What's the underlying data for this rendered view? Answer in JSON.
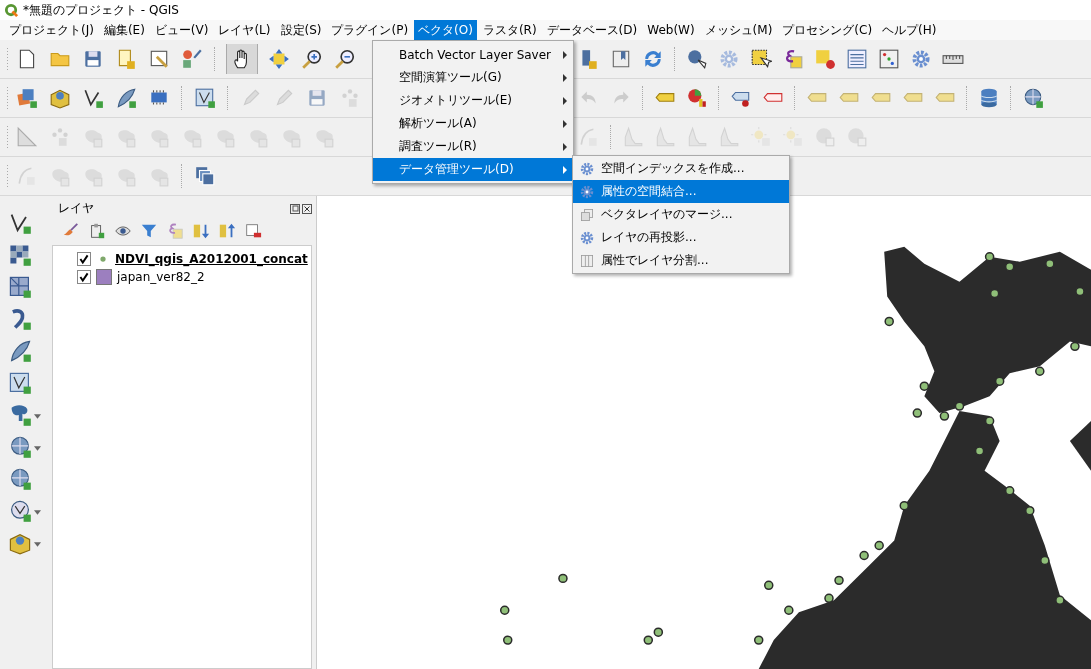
{
  "window": {
    "title": "*無題のプロジェクト - QGIS"
  },
  "menubar": [
    {
      "label": "プロジェクト(J)",
      "selected": false
    },
    {
      "label": "編集(E)",
      "selected": false
    },
    {
      "label": "ビュー(V)",
      "selected": false
    },
    {
      "label": "レイヤ(L)",
      "selected": false
    },
    {
      "label": "設定(S)",
      "selected": false
    },
    {
      "label": "プラグイン(P)",
      "selected": false
    },
    {
      "label": "ベクタ(O)",
      "selected": true
    },
    {
      "label": "ラスタ(R)",
      "selected": false
    },
    {
      "label": "データベース(D)",
      "selected": false
    },
    {
      "label": "Web(W)",
      "selected": false
    },
    {
      "label": "メッシュ(M)",
      "selected": false
    },
    {
      "label": "プロセシング(C)",
      "selected": false
    },
    {
      "label": "ヘルプ(H)",
      "selected": false
    }
  ],
  "vector_menu": [
    {
      "label": "Batch Vector Layer Saver",
      "selected": false
    },
    {
      "label": "空間演算ツール(G)",
      "selected": false
    },
    {
      "label": "ジオメトリツール(E)",
      "selected": false
    },
    {
      "label": "解析ツール(A)",
      "selected": false
    },
    {
      "label": "調査ツール(R)",
      "selected": false
    },
    {
      "label": "データ管理ツール(D)",
      "selected": true
    }
  ],
  "submenu": [
    {
      "label": "空間インデックスを作成...",
      "kind": "gear",
      "selected": false
    },
    {
      "label": "属性の空間結合...",
      "kind": "gear",
      "selected": true
    },
    {
      "label": "ベクタレイヤのマージ...",
      "kind": "merge",
      "selected": false
    },
    {
      "label": "レイヤの再投影...",
      "kind": "gear",
      "selected": false
    },
    {
      "label": "属性でレイヤ分割...",
      "kind": "split",
      "selected": false
    }
  ],
  "layers_panel": {
    "title": "レイヤ",
    "layers": [
      {
        "name": "NDVI_qgis_A2012001_concat",
        "kind": "point",
        "color": "#7fa86b",
        "checked": true,
        "selected": true
      },
      {
        "name": "japan_ver82_2",
        "kind": "polygon",
        "color": "#9c7fbf",
        "checked": true,
        "selected": false
      }
    ]
  }
}
